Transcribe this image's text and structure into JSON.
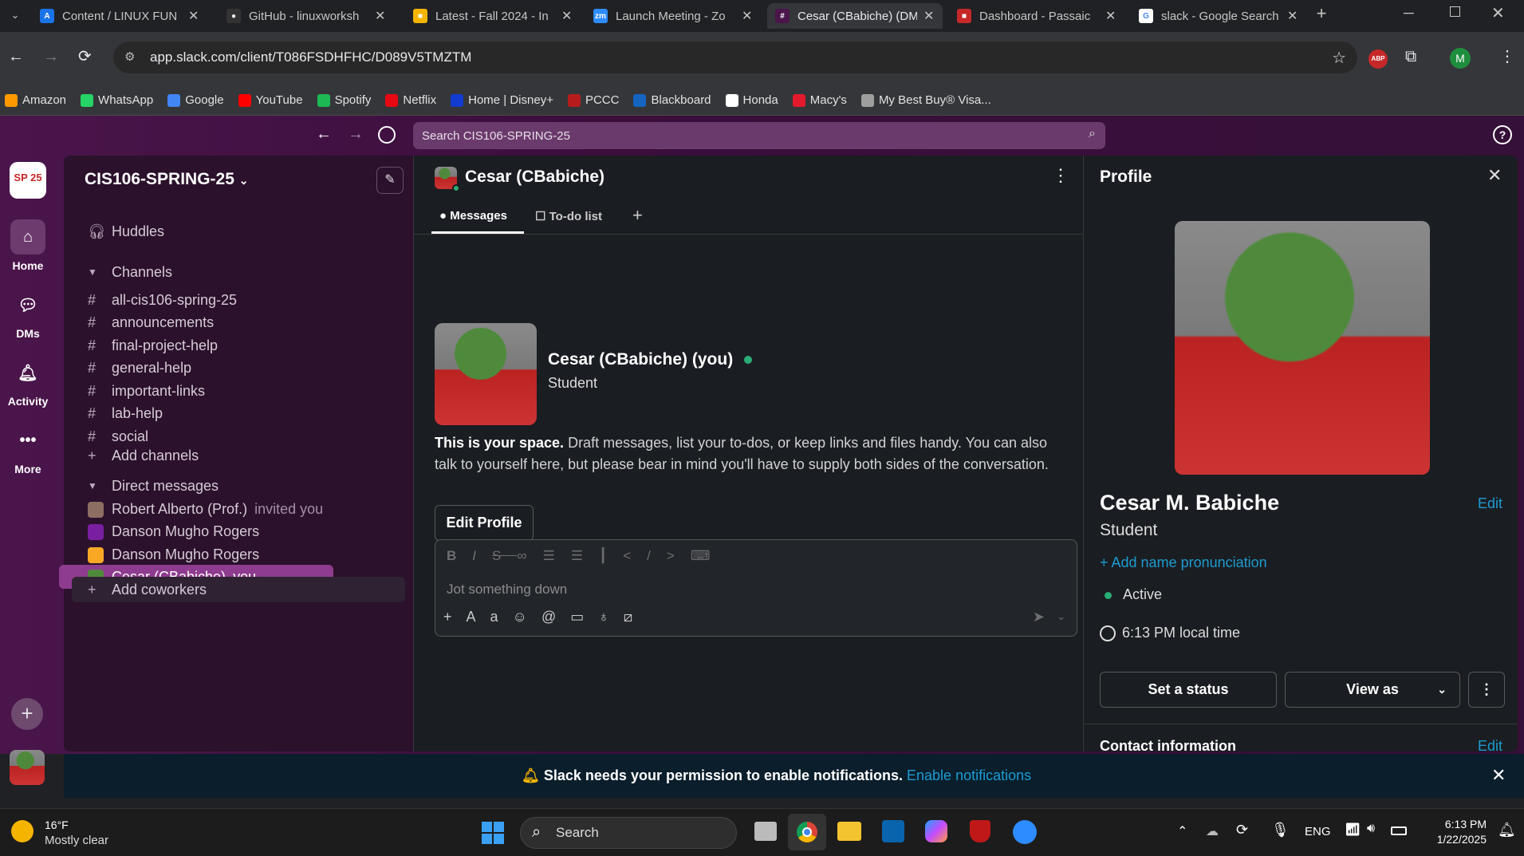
{
  "browser": {
    "tabs": [
      {
        "title": "Content / LINUX FUN",
        "color": "#1a73e8",
        "glyph": "A"
      },
      {
        "title": "GitHub - linuxworksh",
        "color": "#333",
        "glyph": "●"
      },
      {
        "title": "Latest - Fall 2024 - In",
        "color": "#f4b400",
        "glyph": "■"
      },
      {
        "title": "Launch Meeting - Zo",
        "color": "#2d8cff",
        "glyph": "zm"
      },
      {
        "title": "Cesar (CBabiche) (DM",
        "color": "#4a154b",
        "glyph": "#"
      },
      {
        "title": "Dashboard - Passaic",
        "color": "#c62828",
        "glyph": "■"
      },
      {
        "title": "slack - Google Search",
        "color": "#ffffff",
        "glyph": "G"
      }
    ],
    "url": "app.slack.com/client/T086FSDHFHC/D089V5TMZTM",
    "profile_initial": "M",
    "abp_label": "ABP",
    "bookmarks": [
      {
        "label": "Amazon",
        "color": "#ff9900"
      },
      {
        "label": "WhatsApp",
        "color": "#25d366"
      },
      {
        "label": "Google",
        "color": "#4285f4"
      },
      {
        "label": "YouTube",
        "color": "#ff0000"
      },
      {
        "label": "Spotify",
        "color": "#1db954"
      },
      {
        "label": "Netflix",
        "color": "#e50914"
      },
      {
        "label": "Home | Disney+",
        "color": "#113ccf"
      },
      {
        "label": "PCCC",
        "color": "#b71c1c"
      },
      {
        "label": "Blackboard",
        "color": "#1565c0"
      },
      {
        "label": "Honda",
        "color": "#ffffff"
      },
      {
        "label": "Macy's",
        "color": "#e21a2c"
      },
      {
        "label": "My Best Buy® Visa...",
        "color": "#9e9e9e"
      }
    ]
  },
  "slack": {
    "search_placeholder": "Search CIS106-SPRING-25",
    "workspace": {
      "name": "CIS106-SPRING-25",
      "badge": "SP 25"
    },
    "rail": [
      {
        "label": "Home",
        "icon": "home-icon"
      },
      {
        "label": "DMs",
        "icon": "dms-icon"
      },
      {
        "label": "Activity",
        "icon": "bell-icon"
      },
      {
        "label": "More",
        "icon": "more-icon"
      }
    ],
    "sidebar": {
      "huddles": "Huddles",
      "channels_header": "Channels",
      "channels": [
        "all-cis106-spring-25",
        "announcements",
        "final-project-help",
        "general-help",
        "important-links",
        "lab-help",
        "social"
      ],
      "add_channels": "Add channels",
      "dm_header": "Direct messages",
      "dms": [
        {
          "name": "Robert Alberto (Prof.)",
          "suffix": "invited you"
        },
        {
          "name": "Danson Mugho Rogers",
          "suffix": ""
        },
        {
          "name": "Danson Mugho Rogers",
          "suffix": ""
        },
        {
          "name": "Cesar (CBabiche)",
          "suffix": "you"
        }
      ],
      "add_coworkers": "Add coworkers"
    },
    "channel": {
      "title": "Cesar (CBabiche)",
      "tabs": [
        "Messages",
        "To-do list"
      ],
      "intro_name": "Cesar (CBabiche) (you)",
      "intro_role": "Student",
      "intro_bold": "This is your space.",
      "intro_text": " Draft messages, list your to-dos, or keep links and files handy. You can also talk to yourself here, but please bear in mind you'll have to supply both sides of the conversation.",
      "edit_profile": "Edit Profile",
      "composer_placeholder": "Jot something down"
    },
    "profile": {
      "header": "Profile",
      "name": "Cesar M. Babiche",
      "edit": "Edit",
      "role": "Student",
      "pronunciation": "+ Add name pronunciation",
      "status": "Active",
      "local_time": "6:13 PM local time",
      "set_status": "Set a status",
      "view_as": "View as",
      "contact_header": "Contact information",
      "contact_edit": "Edit"
    },
    "notification": {
      "text": "Slack needs your permission to enable notifications.",
      "link": "Enable notifications"
    }
  },
  "taskbar": {
    "weather_temp": "16°F",
    "weather_desc": "Mostly clear",
    "search": "Search",
    "lang": "ENG",
    "time": "6:13 PM",
    "date": "1/22/2025"
  },
  "colors": {
    "accent": "#1d9bd1",
    "active_green": "#2bac76",
    "slack_aubergine": "#4a154b",
    "selected_item": "#8e3c8f"
  }
}
